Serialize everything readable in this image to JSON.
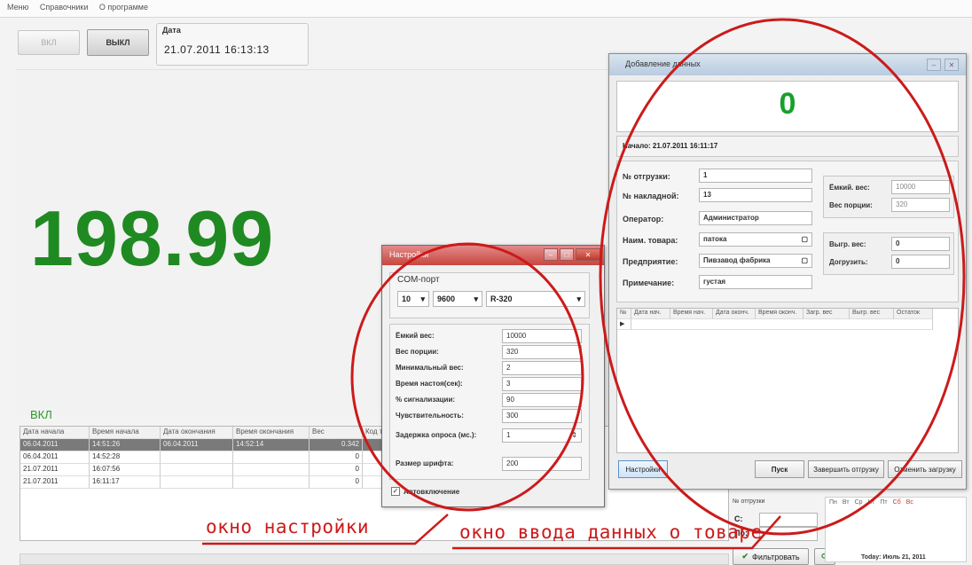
{
  "menu": [
    "Меню",
    "Справочники",
    "О программе"
  ],
  "buttons": {
    "on": "ВКЛ",
    "off": "ВЫКЛ"
  },
  "date_group": {
    "label": "Дата",
    "value": "21.07.2011   16:13:13"
  },
  "display": {
    "weight": "198.99",
    "status": "ВКЛ"
  },
  "table": {
    "headers": [
      "Дата начала",
      "Время начала",
      "Дата окончания",
      "Время окончания",
      "Вес",
      "Код т"
    ],
    "rows": [
      [
        "06.04.2011",
        "14:51:26",
        "06.04.2011",
        "14:52:14",
        "0.342",
        ""
      ],
      [
        "06.04.2011",
        "14:52:28",
        "",
        "",
        "0",
        ""
      ],
      [
        "21.07.2011",
        "16:07:56",
        "",
        "",
        "0",
        ""
      ],
      [
        "21.07.2011",
        "16:11:17",
        "",
        "",
        "0",
        ""
      ]
    ]
  },
  "settings": {
    "title": "Настройки",
    "com_label": "COM-порт",
    "port": "10",
    "baud": "9600",
    "model": "R-320",
    "params": [
      {
        "label": "Ёмкий вес:",
        "value": "10000"
      },
      {
        "label": "Вес порции:",
        "value": "320"
      },
      {
        "label": "Минимальный вес:",
        "value": "2"
      },
      {
        "label": "Время настоя(сек):",
        "value": "3"
      },
      {
        "label": "% сигнализации:",
        "value": "90"
      },
      {
        "label": "Чувствительность:",
        "value": "300"
      },
      {
        "label": "Задержка опроса (мс.):",
        "value": "1"
      },
      {
        "label": "Размер шрифта:",
        "value": "200"
      }
    ],
    "autostart": "Автовключение"
  },
  "entry": {
    "title": "Добавление данных",
    "counter": "0",
    "start": "Начало: 21.07.2011 16:11:17",
    "fields": [
      {
        "label": "№ отгрузки:",
        "value": "1"
      },
      {
        "label": "№ накладной:",
        "value": "13"
      },
      {
        "label": "Оператор:",
        "value": "Администратор"
      },
      {
        "label": "Наим. товара:",
        "value": "патока"
      },
      {
        "label": "Предприятие:",
        "value": "Пивзавод фабрика"
      },
      {
        "label": "Примечание:",
        "value": "густая"
      }
    ],
    "side": [
      {
        "label": "Ёмкий. вес:",
        "value": "10000"
      },
      {
        "label": "Вес порции:",
        "value": "320"
      }
    ],
    "side2": [
      {
        "label": "Выгр. вес:",
        "value": "0"
      },
      {
        "label": "Догрузить:",
        "value": "0"
      }
    ],
    "grid_headers": [
      "№",
      "Дата нач.",
      "Время нач.",
      "Дата оконч.",
      "Время оконч.",
      "Загр. вес",
      "Выгр. вес",
      "Остаток"
    ],
    "settings_btn": "Настройки",
    "buttons": [
      "Пуск",
      "Завершить отгрузку",
      "Отменить загрузку"
    ]
  },
  "behind": {
    "ship_label": "№ отгрузки",
    "c_label": "С:",
    "po_label": "По:",
    "filter": "Фильтровать",
    "cal_days": [
      "Пн",
      "Вт",
      "Ср",
      "Чт",
      "Пт",
      "Сб",
      "Вс"
    ],
    "today": "Today: Июль 21, 2011"
  },
  "annotations": {
    "settings_window": "окно настройки",
    "entry_window": "окно ввода данных о товаре"
  },
  "colors": {
    "weight_green": "#1f8a22",
    "annotation_red": "#cc1a1a",
    "settings_title": "#c8463f"
  }
}
